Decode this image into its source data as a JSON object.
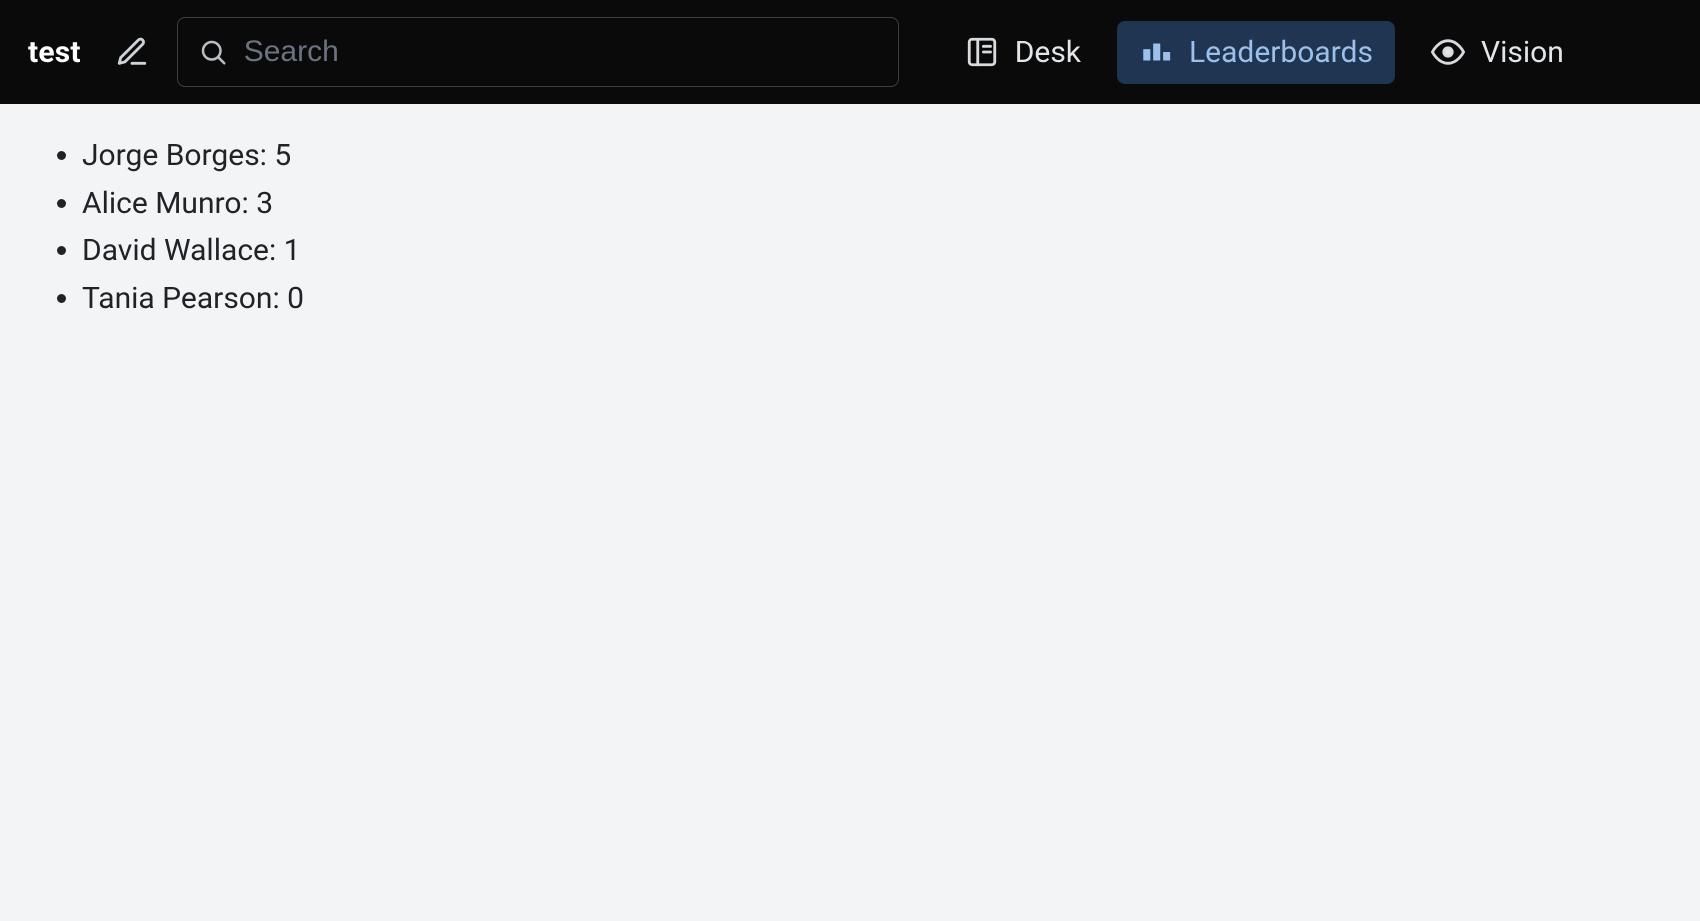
{
  "header": {
    "brand": "test",
    "search": {
      "placeholder": "Search",
      "value": ""
    },
    "nav": {
      "desk": "Desk",
      "leaderboards": "Leaderboards",
      "vision": "Vision"
    }
  },
  "leaderboard": {
    "items": [
      {
        "name": "Jorge Borges",
        "score": 5
      },
      {
        "name": "Alice Munro",
        "score": 3
      },
      {
        "name": "David Wallace",
        "score": 1
      },
      {
        "name": "Tania Pearson",
        "score": 0
      }
    ]
  }
}
